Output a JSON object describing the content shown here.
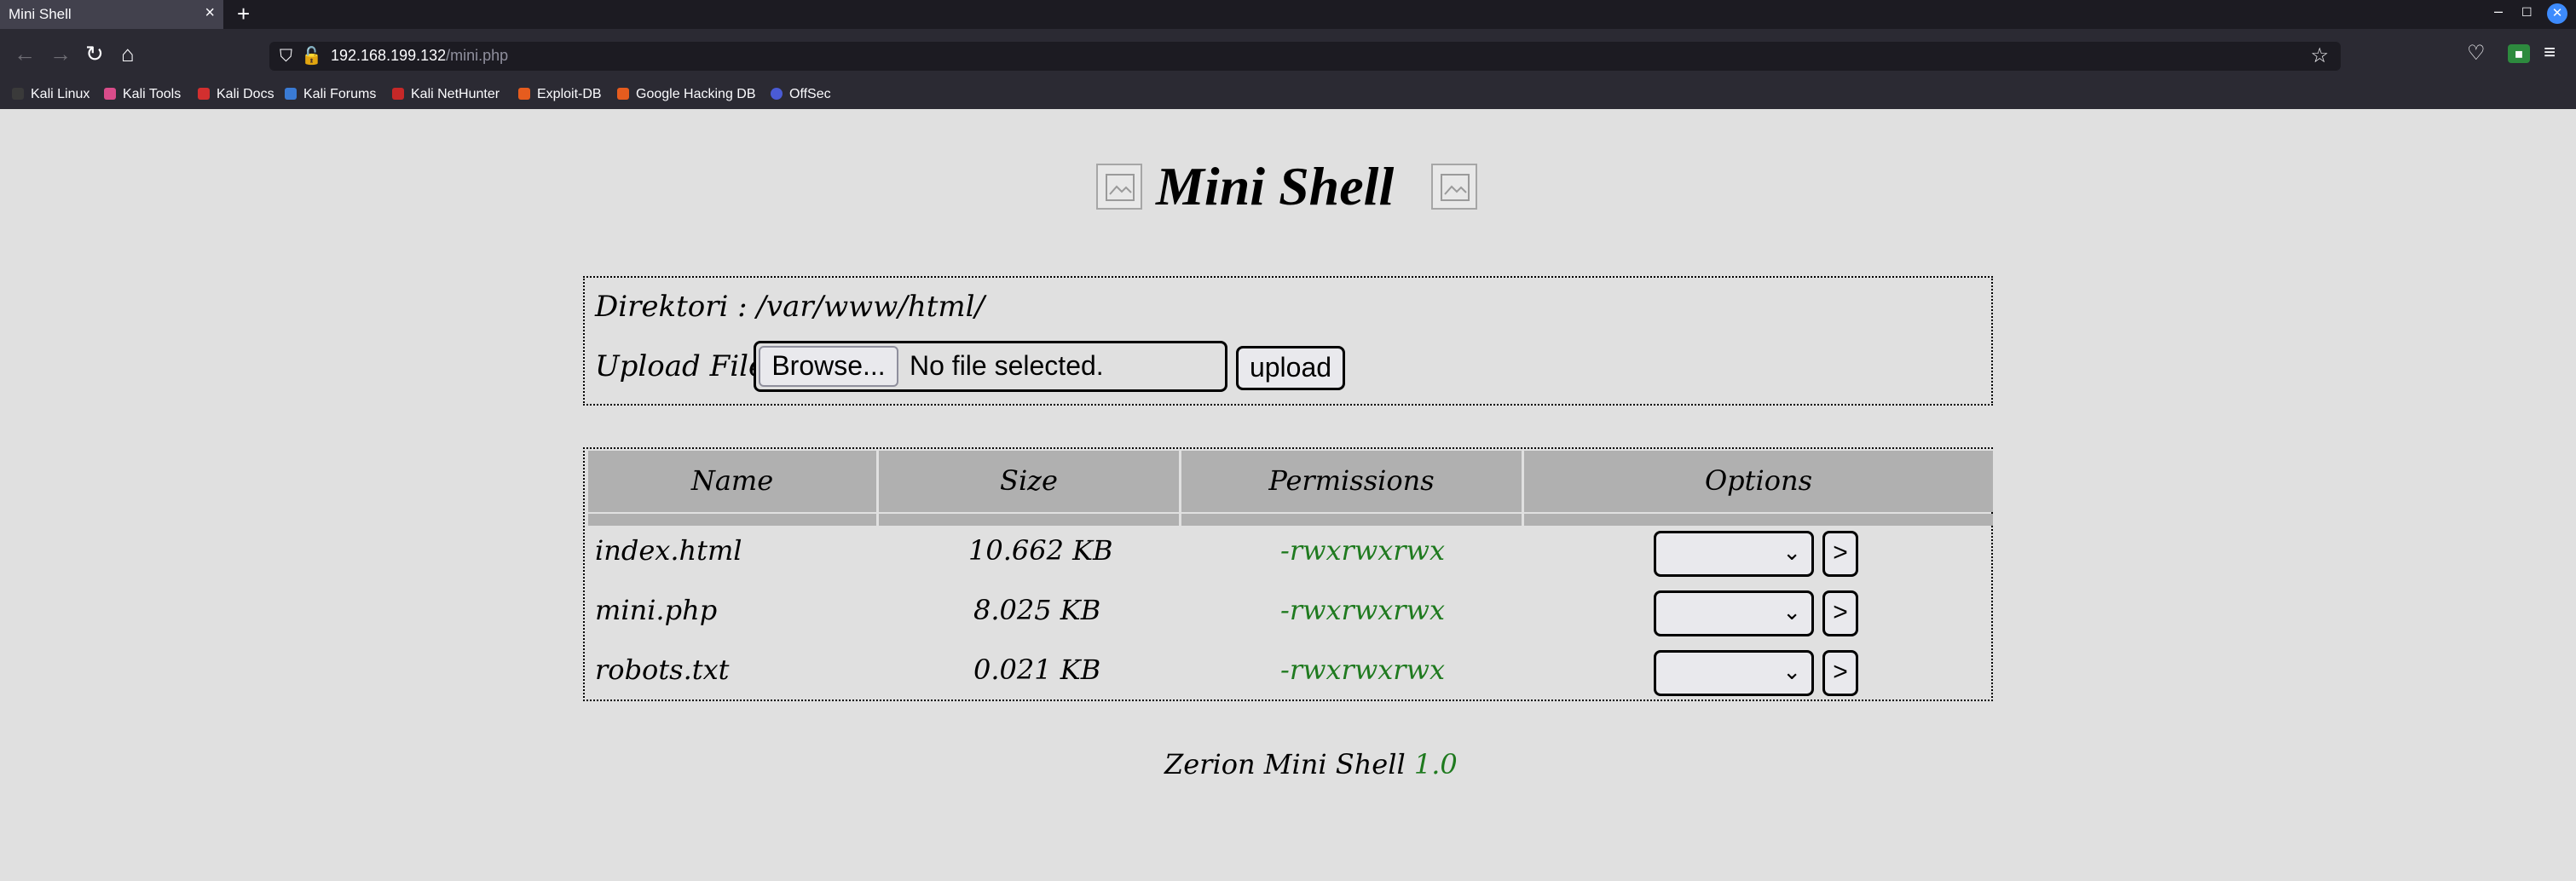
{
  "browser": {
    "tab_title": "Mini Shell",
    "tab_close": "×",
    "new_tab": "+",
    "url_host": "192.168.199.132",
    "url_path": "/mini.php",
    "bookmarks": [
      "Kali Linux",
      "Kali Tools",
      "Kali Docs",
      "Kali Forums",
      "Kali NetHunter",
      "Exploit-DB",
      "Google Hacking DB",
      "OffSec"
    ]
  },
  "page": {
    "title": "Mini Shell",
    "directory_label": "Direktori : /var/www/html/",
    "upload_label": "Upload File :",
    "browse_button": "Browse...",
    "no_file_text": "No file selected.",
    "upload_button": "upload",
    "table": {
      "headers": [
        "Name",
        "Size",
        "Permissions",
        "Options"
      ],
      "rows": [
        {
          "name": "index.html",
          "size": "10.662 KB",
          "permissions": "-rwxrwxrwx",
          "go": ">"
        },
        {
          "name": "mini.php",
          "size": "8.025 KB",
          "permissions": "-rwxrwxrwx",
          "go": ">"
        },
        {
          "name": "robots.txt",
          "size": "0.021 KB",
          "permissions": "-rwxrwxrwx",
          "go": ">"
        }
      ]
    },
    "footer_text": "Zerion Mini Shell ",
    "footer_version": "1.0"
  },
  "colors": {
    "page_bg": "#e0e0e0",
    "header_bg": "#b0b0b0",
    "permission_green": "#1f7a1f"
  }
}
